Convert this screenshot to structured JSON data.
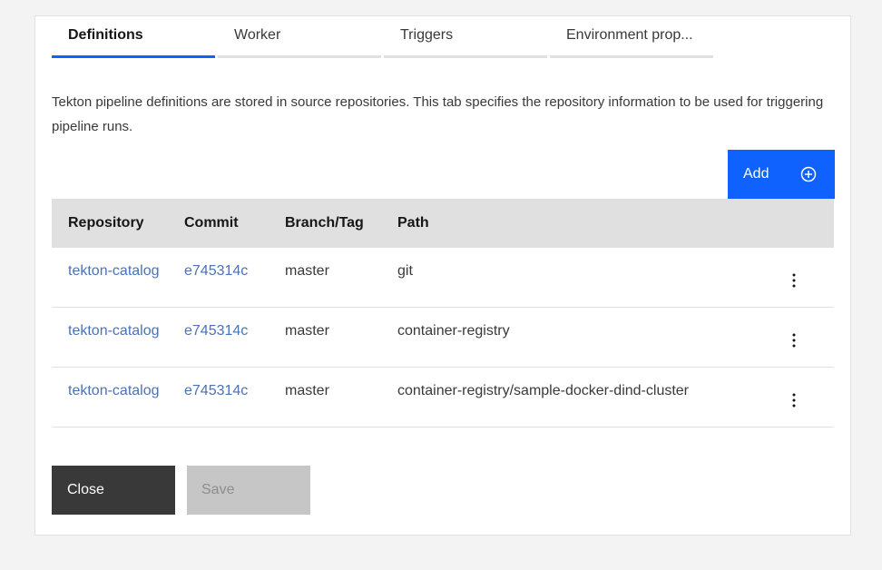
{
  "tabs": [
    {
      "label": "Definitions",
      "active": true
    },
    {
      "label": "Worker",
      "active": false
    },
    {
      "label": "Triggers",
      "active": false
    },
    {
      "label": "Environment prop...",
      "active": false
    }
  ],
  "description": "Tekton pipeline definitions are stored in source repositories. This tab specifies the repository information to be used for triggering pipeline runs.",
  "add_button": {
    "label": "Add",
    "icon": "add-circle-icon"
  },
  "table": {
    "headers": [
      "Repository",
      "Commit",
      "Branch/Tag",
      "Path"
    ],
    "rows": [
      {
        "repository": "tekton-catalog",
        "commit": "e745314c",
        "branch": "master",
        "path": "git"
      },
      {
        "repository": "tekton-catalog",
        "commit": "e745314c",
        "branch": "master",
        "path": "container-registry"
      },
      {
        "repository": "tekton-catalog",
        "commit": "e745314c",
        "branch": "master",
        "path": "container-registry/sample-docker-dind-cluster"
      }
    ]
  },
  "footer": {
    "close_label": "Close",
    "save_label": "Save"
  },
  "colors": {
    "accent": "#0f62fe",
    "link": "#4a72b5",
    "close_bg": "#393939",
    "save_disabled_bg": "#c6c6c6"
  }
}
